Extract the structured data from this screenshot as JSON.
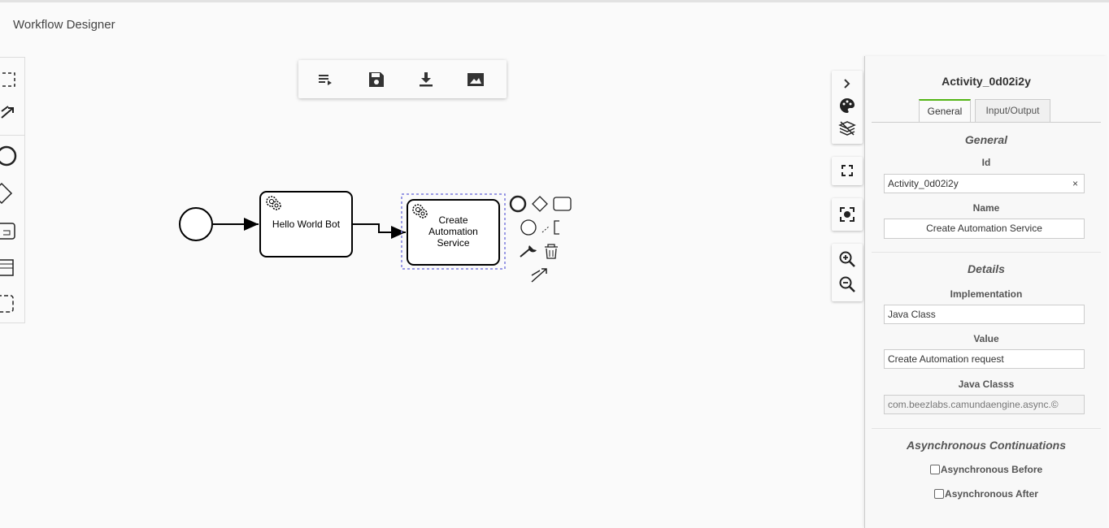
{
  "app": {
    "title": "Workflow Designer"
  },
  "diagram": {
    "task1": {
      "label": "Hello World Bot"
    },
    "task2": {
      "line1": "Create",
      "line2": "Automation",
      "line3": "Service"
    }
  },
  "panel": {
    "title": "Activity_0d02i2y",
    "tabs": [
      {
        "label": "General",
        "active": true
      },
      {
        "label": "Input/Output",
        "active": false
      }
    ],
    "general": {
      "group_title": "General",
      "id_label": "Id",
      "id_value": "Activity_0d02i2y",
      "name_label": "Name",
      "name_value": "Create Automation Service"
    },
    "details": {
      "group_title": "Details",
      "implementation_label": "Implementation",
      "implementation_value": "Java Class",
      "value_label": "Value",
      "value_value": "Create Automation request",
      "java_class_label": "Java Classs",
      "java_class_value": "com.beezlabs.camundaengine.async.©"
    },
    "async": {
      "group_title": "Asynchronous Continuations",
      "before_label": "Asynchronous Before",
      "after_label": "Asynchronous After"
    }
  },
  "icons": {
    "toolbar": [
      "list-icon",
      "save-icon",
      "download-icon",
      "image-icon"
    ],
    "right_strip": [
      "chevron-right-icon",
      "palette-icon",
      "layers-icon",
      "fullscreen-icon",
      "focus-icon",
      "zoom-in-icon",
      "zoom-out-icon"
    ]
  },
  "colors": {
    "tab_accent": "#52b415",
    "selection": "#7b7bdc"
  }
}
